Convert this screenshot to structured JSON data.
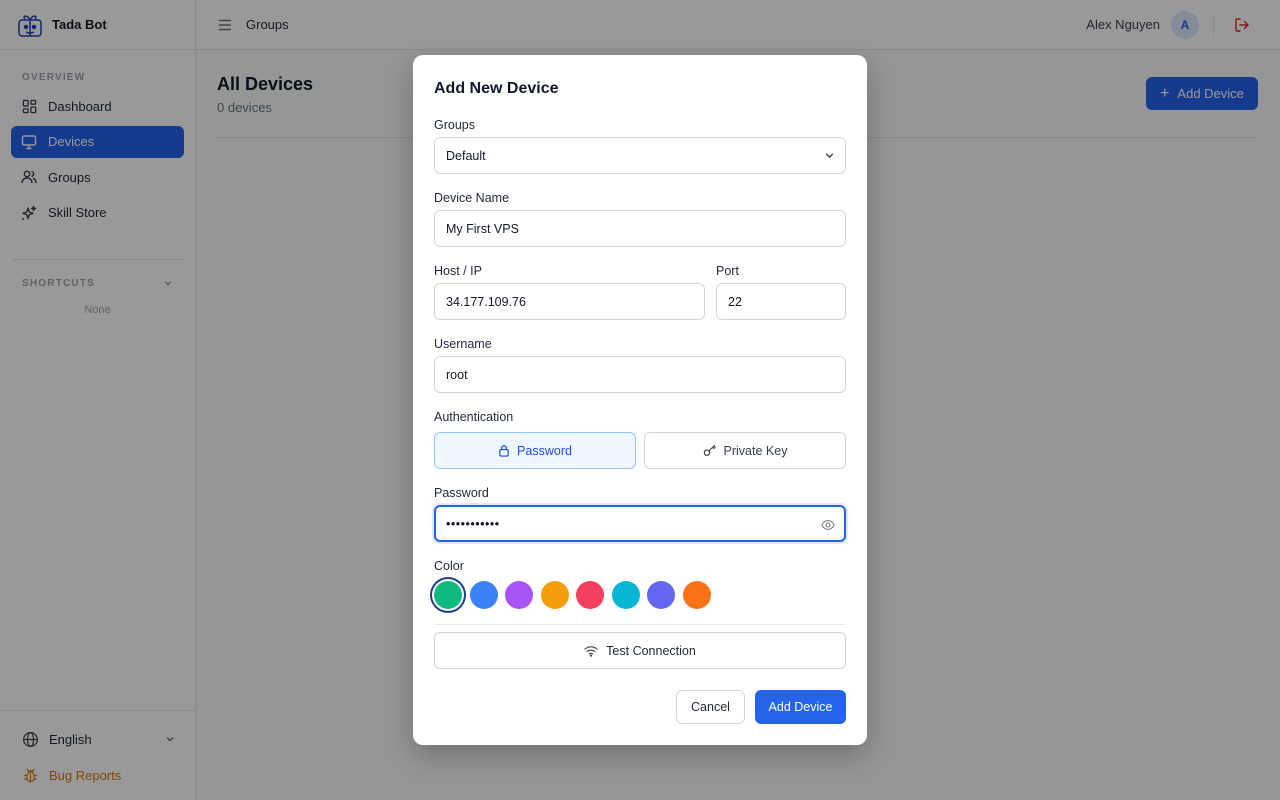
{
  "app": {
    "name": "Tada Bot",
    "logo_icon": "gift-robot-logo-icon"
  },
  "sidebar": {
    "overview_label": "OVERVIEW",
    "items": [
      {
        "label": "Dashboard",
        "icon": "grid-icon",
        "active": false
      },
      {
        "label": "Devices",
        "icon": "monitor-icon",
        "active": true
      },
      {
        "label": "Groups",
        "icon": "users-icon",
        "active": false
      },
      {
        "label": "Skill Store",
        "icon": "sparkle-icon",
        "active": false
      }
    ],
    "shortcuts_label": "SHORTCUTS",
    "shortcuts_empty": "None",
    "language": "English",
    "bug_reports": "Bug Reports"
  },
  "topbar": {
    "breadcrumb": "Groups",
    "user_name": "Alex Nguyen",
    "avatar_initial": "A"
  },
  "main": {
    "title": "All Devices",
    "subtitle": "0 devices",
    "add_button": "Add Device"
  },
  "modal": {
    "title": "Add New Device",
    "groups_label": "Groups",
    "groups_value": "Default",
    "device_name_label": "Device Name",
    "device_name_value": "My First VPS",
    "host_label": "Host / IP",
    "host_value": "34.177.109.76",
    "port_label": "Port",
    "port_value": "22",
    "username_label": "Username",
    "username_value": "root",
    "auth_label": "Authentication",
    "auth_options": [
      {
        "label": "Password",
        "icon": "lock-icon",
        "selected": true
      },
      {
        "label": "Private Key",
        "icon": "key-icon",
        "selected": false
      }
    ],
    "password_label": "Password",
    "password_value": "•••••••••••",
    "color_label": "Color",
    "colors": [
      "#10b981",
      "#3b82f6",
      "#a855f7",
      "#f59e0b",
      "#f43f5e",
      "#06b6d4",
      "#6366f1",
      "#f97316"
    ],
    "selected_color": "#10b981",
    "test_button": "Test Connection",
    "cancel_button": "Cancel",
    "submit_button": "Add Device"
  },
  "theme": {
    "accent": "#2563eb",
    "bug_color": "#d97706",
    "logout_color": "#dc2626"
  }
}
